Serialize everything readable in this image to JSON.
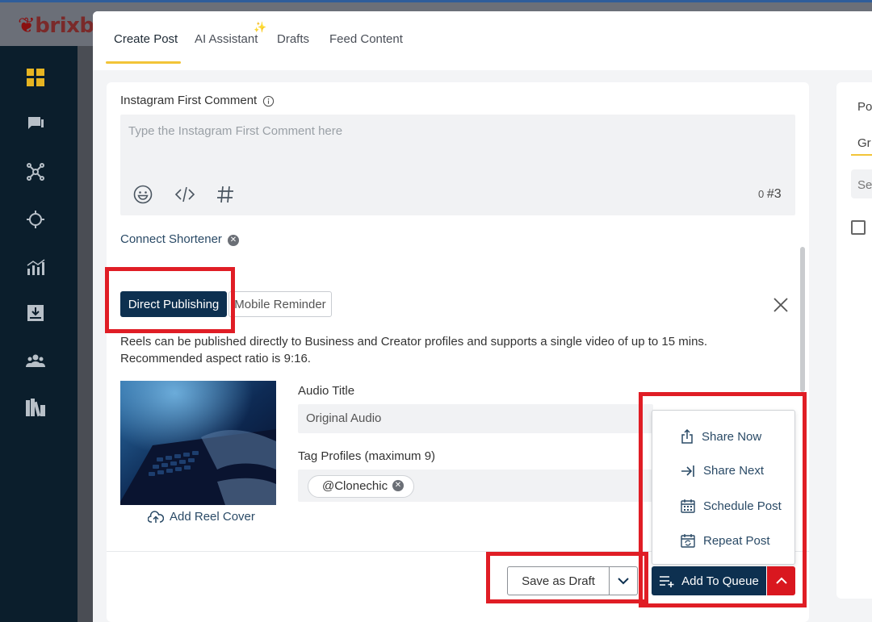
{
  "app": {
    "logo_text": "brixb"
  },
  "tabs": [
    {
      "label": "Create Post",
      "active": true
    },
    {
      "label": "AI Assistant",
      "active": false
    },
    {
      "label": "Drafts",
      "active": false
    },
    {
      "label": "Feed Content",
      "active": false
    }
  ],
  "ai_sparkle": "✨",
  "first_comment": {
    "label": "Instagram First Comment",
    "placeholder": "Type the Instagram First Comment here",
    "counter_chars": "0",
    "counter_hashtags": "#3"
  },
  "shortener": {
    "label": "Connect Shortener"
  },
  "publish_tabs": {
    "direct": "Direct Publishing",
    "reminder": "Mobile Reminder"
  },
  "description": "Reels can be published directly to Business and Creator profiles and supports a single video of up to 15 mins. Recommended aspect ratio is 9:16.",
  "reel": {
    "add_cover": "Add Reel Cover"
  },
  "audio": {
    "label": "Audio Title",
    "value": "Original Audio"
  },
  "tag_profiles": {
    "label": "Tag Profiles (maximum 9)",
    "chips": [
      "@Clonechic"
    ]
  },
  "right_panel": {
    "text1": "Po",
    "text2": "Gr",
    "text3": "Se"
  },
  "menu": {
    "items": [
      {
        "label": "Share Now",
        "icon": "share-icon"
      },
      {
        "label": "Share Next",
        "icon": "arrow-to-line-icon"
      },
      {
        "label": "Schedule Post",
        "icon": "calendar-icon"
      },
      {
        "label": "Repeat Post",
        "icon": "repeat-calendar-icon"
      }
    ]
  },
  "footer": {
    "save_draft": "Save as Draft",
    "add_to_queue": "Add To Queue"
  },
  "colors": {
    "primary": "#0d3050",
    "accent": "#f2c438",
    "highlight": "#e01d25",
    "sidebar": "#0b1e2c"
  }
}
